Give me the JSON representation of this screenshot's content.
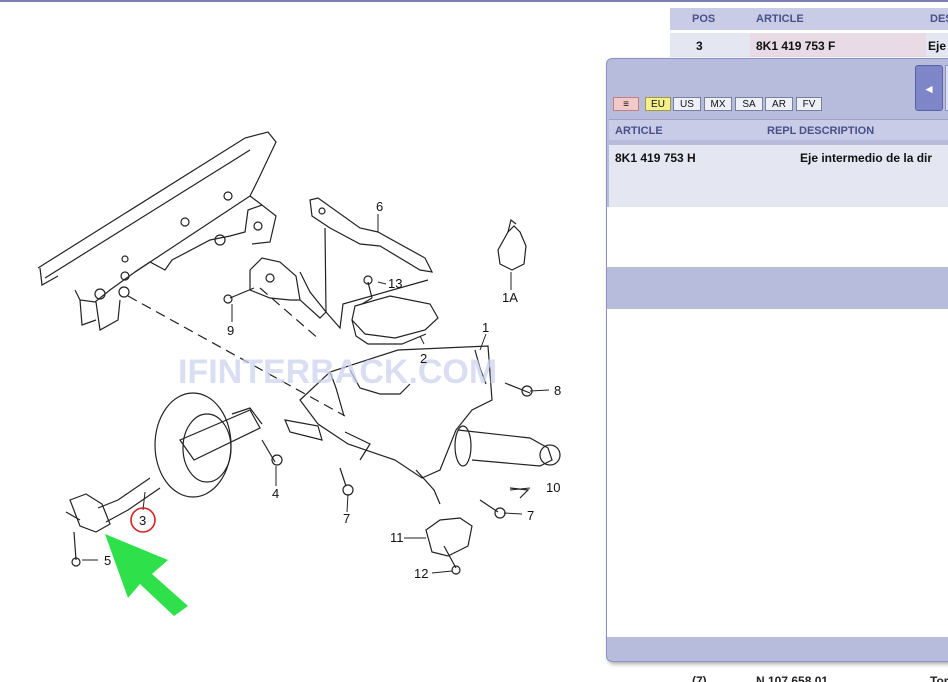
{
  "diagram": {
    "callouts": [
      "1",
      "1A",
      "2",
      "3",
      "4",
      "5",
      "6",
      "7",
      "7",
      "8",
      "9",
      "10",
      "11",
      "12",
      "13"
    ],
    "watermark": "IFINTERBACK.COM",
    "colors": {
      "highlight_circle": "#d22222",
      "arrow": "#2ee04a",
      "line": "#222222"
    }
  },
  "parts_table": {
    "headers": {
      "pos": "POS",
      "article": "ARTICLE",
      "desc": "DES"
    },
    "row": {
      "pos": "3",
      "article": "8K1 419 753 F",
      "desc": "Eje"
    },
    "bottom_row": {
      "pos": "(7)",
      "article": "N  107 658 01",
      "desc": "Tor"
    }
  },
  "popup": {
    "markets": [
      "≡",
      "EU",
      "US",
      "MX",
      "SA",
      "AR",
      "FV"
    ],
    "selected_market": "EU",
    "nav_prev": "◄",
    "headers": {
      "article": "ARTICLE",
      "repl": "REPL",
      "description": "DESCRIPTION"
    },
    "row": {
      "article": "8K1 419 753 H",
      "description": "Eje intermedio de la dir"
    }
  }
}
